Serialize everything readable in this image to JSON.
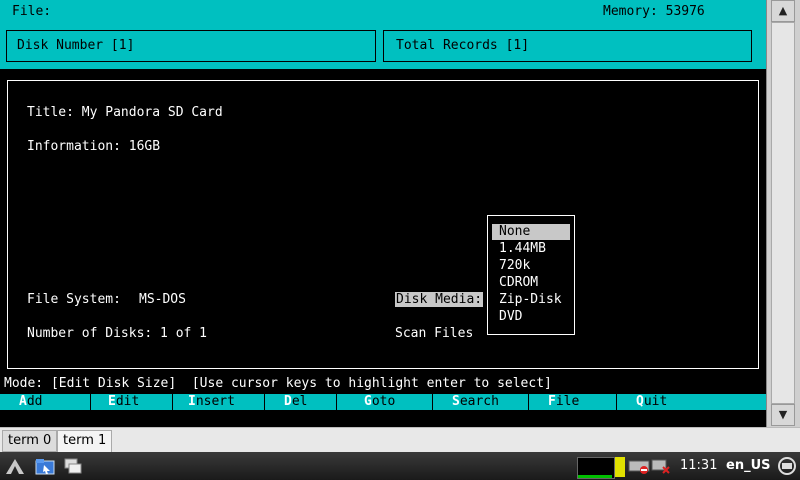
{
  "terminal": {
    "menu_file": "File:",
    "memory": "Memory: 53976",
    "disk_number": "Disk Number [1]",
    "total_records": "Total Records [1]",
    "title_line": "Title: My Pandora SD Card",
    "info_line": "Information: 16GB",
    "file_system_label": "File System:",
    "file_system_value": "MS-DOS",
    "disk_media_label": "Disk Media:",
    "num_disks_line": "Number of Disks: 1 of 1",
    "scan_files": "Scan Files",
    "dropdown_options": [
      "None",
      "1.44MB",
      "720k",
      "CDROM",
      "Zip-Disk",
      "DVD"
    ],
    "selected_option": "None",
    "mode_line": "Mode: [Edit Disk Size]  [Use cursor keys to highlight enter to select]",
    "function_keys": [
      {
        "hot": "A",
        "rest": "dd"
      },
      {
        "hot": "E",
        "rest": "dit"
      },
      {
        "hot": "I",
        "rest": "nsert"
      },
      {
        "hot": "D",
        "rest": "el"
      },
      {
        "hot": "G",
        "rest": "oto"
      },
      {
        "hot": "S",
        "rest": "earch"
      },
      {
        "hot": "F",
        "rest": "ile"
      },
      {
        "hot": "Q",
        "rest": "uit"
      }
    ]
  },
  "tabs": [
    "term 0",
    "term 1"
  ],
  "active_tab": "term 1",
  "taskbar": {
    "clock": "11:31",
    "locale": "en_US",
    "icons": [
      "menu-logo-icon",
      "file-manager-icon",
      "windows-icon",
      "cpu-monitor-icon",
      "battery-icon",
      "keyboard-icon",
      "network-icon",
      "volume-icon",
      "screen-icon"
    ]
  },
  "colors": {
    "accent": "#00c0c0",
    "highlight": "#c8c8c8",
    "background": "#000000"
  }
}
